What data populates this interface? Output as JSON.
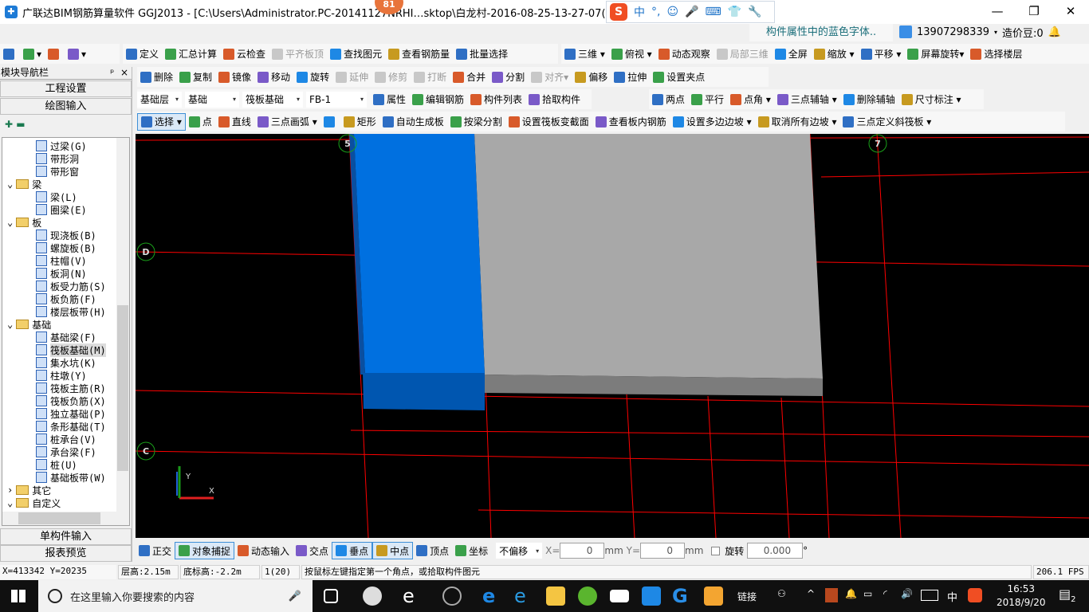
{
  "title_bar": {
    "title": "广联达BIM钢筋算量软件 GGJ2013 - [C:\\Users\\Administrator.PC-20141127NRHI…sktop\\白龙村-2016-08-25-13-27-07(2166版).GG",
    "notification_count": "81",
    "minimize": "—",
    "restore": "❐",
    "close": "✕"
  },
  "ime_bar": {
    "logo": "S",
    "items": [
      "中",
      "°,",
      "☺",
      "🎤",
      "⌨",
      "👕",
      "🔧"
    ]
  },
  "header": {
    "notice": "构件属性中的蓝色字体..",
    "phone": "13907298339",
    "beans": "造价豆:0"
  },
  "toolbars": {
    "file": [
      {
        "l": "",
        "n": "new-file"
      },
      {
        "l": "▾",
        "n": "open-file"
      },
      {
        "l": "",
        "n": "save"
      },
      {
        "l": "▾",
        "n": "undo"
      }
    ],
    "main": [
      {
        "l": "定义",
        "n": "define"
      },
      {
        "l": "汇总计算",
        "n": "summary-calc"
      },
      {
        "l": "云检查",
        "n": "cloud-check"
      },
      {
        "l": "平齐板顶",
        "n": "align-slab-top",
        "d": 1
      },
      {
        "l": "查找图元",
        "n": "find-element"
      },
      {
        "l": "查看钢筋量",
        "n": "view-rebar-amount"
      },
      {
        "l": "批量选择",
        "n": "batch-select"
      }
    ],
    "view": [
      {
        "l": "三维 ▾",
        "n": "3d"
      },
      {
        "l": "俯视 ▾",
        "n": "top-view"
      },
      {
        "l": "动态观察",
        "n": "dynamic-orbit"
      },
      {
        "l": "局部三维",
        "n": "partial-3d",
        "d": 1
      },
      {
        "l": "全屏",
        "n": "fullscreen"
      },
      {
        "l": "缩放 ▾",
        "n": "zoom"
      },
      {
        "l": "平移 ▾",
        "n": "pan"
      },
      {
        "l": "屏幕旋转▾",
        "n": "screen-rotate"
      },
      {
        "l": "选择楼层",
        "n": "select-floor"
      }
    ],
    "edit": [
      {
        "l": "删除",
        "n": "delete"
      },
      {
        "l": "复制",
        "n": "copy"
      },
      {
        "l": "镜像",
        "n": "mirror"
      },
      {
        "l": "移动",
        "n": "move"
      },
      {
        "l": "旋转",
        "n": "rotate"
      },
      {
        "l": "延伸",
        "n": "extend",
        "d": 1
      },
      {
        "l": "修剪",
        "n": "trim",
        "d": 1
      },
      {
        "l": "打断",
        "n": "break",
        "d": 1
      },
      {
        "l": "合并",
        "n": "merge"
      },
      {
        "l": "分割",
        "n": "split"
      },
      {
        "l": "对齐▾",
        "n": "align",
        "d": 1
      },
      {
        "l": "偏移",
        "n": "offset"
      },
      {
        "l": "拉伸",
        "n": "stretch"
      },
      {
        "l": "设置夹点",
        "n": "set-grip"
      }
    ],
    "props": [
      {
        "l": "属性",
        "n": "properties"
      },
      {
        "l": "编辑钢筋",
        "n": "edit-rebar"
      },
      {
        "l": "构件列表",
        "n": "component-list"
      },
      {
        "l": "拾取构件",
        "n": "pick-component"
      }
    ],
    "axis": [
      {
        "l": "两点",
        "n": "two-point"
      },
      {
        "l": "平行",
        "n": "parallel"
      },
      {
        "l": "点角 ▾",
        "n": "point-angle"
      },
      {
        "l": "三点辅轴 ▾",
        "n": "three-point-aux-axis"
      },
      {
        "l": "删除辅轴",
        "n": "delete-aux-axis"
      },
      {
        "l": "尺寸标注 ▾",
        "n": "dimension"
      }
    ],
    "draw": [
      {
        "l": "选择 ▾",
        "n": "select",
        "a": 1
      },
      {
        "l": "点",
        "n": "point"
      },
      {
        "l": "直线",
        "n": "line"
      },
      {
        "l": "三点画弧 ▾",
        "n": "three-point-arc"
      },
      {
        "l": "",
        "n": "arc-mode-select"
      },
      {
        "l": "矩形",
        "n": "rectangle"
      },
      {
        "l": "自动生成板",
        "n": "auto-generate-slab"
      },
      {
        "l": "按梁分割",
        "n": "split-by-beam"
      },
      {
        "l": "设置筏板变截面",
        "n": "set-raft-variable-section"
      },
      {
        "l": "查看板内钢筋",
        "n": "view-slab-rebar"
      },
      {
        "l": "设置多边边坡 ▾",
        "n": "set-multi-edge-slope"
      },
      {
        "l": "取消所有边坡 ▾",
        "n": "cancel-all-slopes"
      },
      {
        "l": "三点定义斜筏板 ▾",
        "n": "three-point-sloped-raft"
      }
    ],
    "snap": [
      {
        "l": "正交",
        "n": "orthogonal"
      },
      {
        "l": "对象捕捉",
        "n": "object-snap",
        "a": 1
      },
      {
        "l": "动态输入",
        "n": "dynamic-input"
      },
      {
        "l": "交点",
        "n": "intersection"
      },
      {
        "l": "垂点",
        "n": "perpendicular",
        "a": 1
      },
      {
        "l": "中点",
        "n": "midpoint",
        "a": 1
      },
      {
        "l": "顶点",
        "n": "vertex"
      },
      {
        "l": "坐标",
        "n": "coordinate"
      }
    ]
  },
  "selectors": {
    "floor": "基础层",
    "category": "基础",
    "type": "筏板基础",
    "component": "FB-1"
  },
  "nav": {
    "title": "模块导航栏",
    "pin": "ᵖ",
    "close": "×",
    "project_settings": "工程设置",
    "drawing_input": "绘图输入",
    "single_input": "单构件输入",
    "report_preview": "报表预览",
    "tree": [
      {
        "l": "过梁(G)",
        "lv": 2
      },
      {
        "l": "带形洞",
        "lv": 2
      },
      {
        "l": "带形窗",
        "lv": 2
      },
      {
        "l": "梁",
        "lv": 1,
        "open": true
      },
      {
        "l": "梁(L)",
        "lv": 2
      },
      {
        "l": "圈梁(E)",
        "lv": 2
      },
      {
        "l": "板",
        "lv": 1,
        "open": true
      },
      {
        "l": "现浇板(B)",
        "lv": 2
      },
      {
        "l": "螺旋板(B)",
        "lv": 2
      },
      {
        "l": "柱帽(V)",
        "lv": 2
      },
      {
        "l": "板洞(N)",
        "lv": 2
      },
      {
        "l": "板受力筋(S)",
        "lv": 2
      },
      {
        "l": "板负筋(F)",
        "lv": 2
      },
      {
        "l": "楼层板带(H)",
        "lv": 2
      },
      {
        "l": "基础",
        "lv": 1,
        "open": true
      },
      {
        "l": "基础梁(F)",
        "lv": 2
      },
      {
        "l": "筏板基础(M)",
        "lv": 2,
        "sel": true
      },
      {
        "l": "集水坑(K)",
        "lv": 2
      },
      {
        "l": "柱墩(Y)",
        "lv": 2
      },
      {
        "l": "筏板主筋(R)",
        "lv": 2
      },
      {
        "l": "筏板负筋(X)",
        "lv": 2
      },
      {
        "l": "独立基础(P)",
        "lv": 2
      },
      {
        "l": "条形基础(T)",
        "lv": 2
      },
      {
        "l": "桩承台(V)",
        "lv": 2
      },
      {
        "l": "承台梁(F)",
        "lv": 2
      },
      {
        "l": "桩(U)",
        "lv": 2
      },
      {
        "l": "基础板带(W)",
        "lv": 2
      },
      {
        "l": "其它",
        "lv": 1,
        "open": false
      },
      {
        "l": "自定义",
        "lv": 1,
        "open": true
      }
    ]
  },
  "canvas": {
    "axis_labels": [
      "5",
      "7",
      "D",
      "C"
    ],
    "ucs_x": "X",
    "ucs_y": "Y",
    "colors": {
      "grid": "#ff0000",
      "slab_blue": "#0070e0",
      "slab_gray": "#a8a8a8",
      "axis_marker": "#1aa01a"
    }
  },
  "bottom": {
    "offset": "不偏移",
    "x_label": "X=",
    "x_value": "0",
    "y_label": "Y=",
    "y_value": "0",
    "unit": "mm",
    "rotate_label": "旋转",
    "rotate_value": "0.000",
    "degree": "°"
  },
  "status": {
    "coords": "X=413342 Y=20235",
    "floor_height": "层高:2.15m",
    "bottom_elev": "底标高:-2.2m",
    "count": "1(20)",
    "hint": "按鼠标左键指定第一个角点，或拾取构件图元",
    "fps": "206.1 FPS"
  },
  "taskbar": {
    "search_placeholder": "在这里输入你要搜索的内容",
    "links": "链接",
    "ime": "中",
    "time": "16:53",
    "date": "2018/9/20",
    "notifications": "2"
  }
}
